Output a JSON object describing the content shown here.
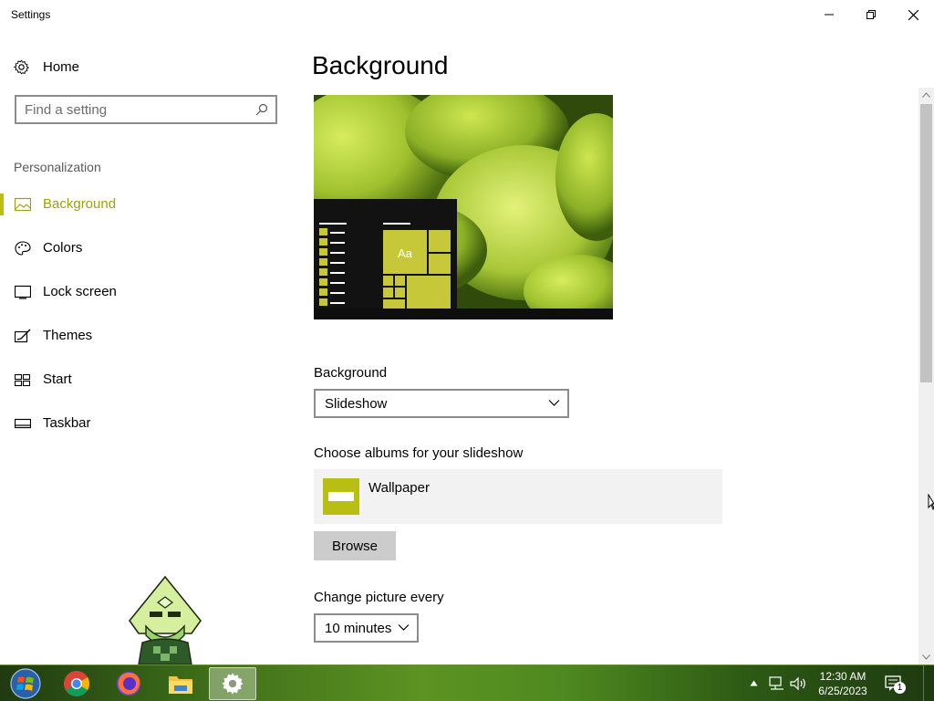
{
  "window": {
    "title": "Settings",
    "minimize_icon": "minimize-icon",
    "maximize_icon": "restore-icon",
    "close_icon": "close-icon"
  },
  "sidebar": {
    "home_label": "Home",
    "search_placeholder": "Find a setting",
    "section_label": "Personalization",
    "items": [
      {
        "label": "Background",
        "icon": "picture-icon",
        "active": true
      },
      {
        "label": "Colors",
        "icon": "palette-icon",
        "active": false
      },
      {
        "label": "Lock screen",
        "icon": "lock-screen-icon",
        "active": false
      },
      {
        "label": "Themes",
        "icon": "themes-icon",
        "active": false
      },
      {
        "label": "Start",
        "icon": "start-icon",
        "active": false
      },
      {
        "label": "Taskbar",
        "icon": "taskbar-icon",
        "active": false
      }
    ]
  },
  "main": {
    "page_title": "Background",
    "preview_tile_text": "Aa",
    "background_label": "Background",
    "background_value": "Slideshow",
    "albums_label": "Choose albums for your slideshow",
    "album_name": "Wallpaper",
    "browse_label": "Browse",
    "change_label": "Change picture every",
    "change_value": "10 minutes"
  },
  "taskbar": {
    "apps": [
      "start-orb",
      "chrome-icon",
      "firefox-icon",
      "file-explorer-icon",
      "settings-gear-icon"
    ],
    "clock_time": "12:30 AM",
    "clock_date": "6/25/2023",
    "notification_count": "1"
  },
  "colors": {
    "accent": "#b8bf12",
    "accent_text": "#9ba20c",
    "album_bg": "#f2f2f2",
    "button_bg": "#cccccc"
  }
}
